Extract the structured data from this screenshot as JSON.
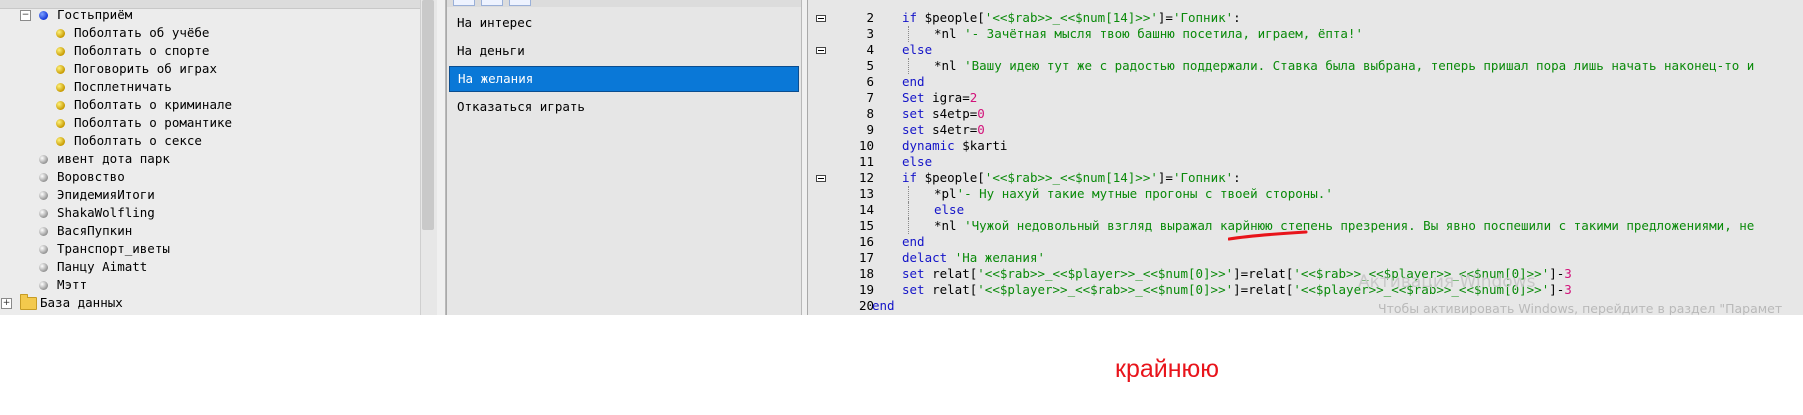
{
  "tree": {
    "items": [
      {
        "label": "Гостьприём",
        "level": 1,
        "icon": "blue-bullet-icon",
        "expander": "−"
      },
      {
        "label": "Поболтать об учёбе",
        "level": 2,
        "icon": "yellow-bullet-icon"
      },
      {
        "label": "Поболтать о спорте",
        "level": 2,
        "icon": "yellow-bullet-icon"
      },
      {
        "label": "Поговорить об играх",
        "level": 2,
        "icon": "yellow-bullet-icon"
      },
      {
        "label": "Посплетничать",
        "level": 2,
        "icon": "yellow-bullet-icon"
      },
      {
        "label": "Поболтать о криминале",
        "level": 2,
        "icon": "yellow-bullet-icon"
      },
      {
        "label": "Поболтать о романтике",
        "level": 2,
        "icon": "yellow-bullet-icon"
      },
      {
        "label": "Поболтать о сексе",
        "level": 2,
        "icon": "yellow-bullet-icon"
      },
      {
        "label": "ивент дота парк",
        "level": 1,
        "icon": "gray-bullet-icon"
      },
      {
        "label": "Воровство",
        "level": 1,
        "icon": "gray-bullet-icon"
      },
      {
        "label": "ЭпидемияИтоги",
        "level": 1,
        "icon": "gray-bullet-icon"
      },
      {
        "label": "ShakaWolfling",
        "level": 1,
        "icon": "gray-bullet-icon"
      },
      {
        "label": "ВасяПупкин",
        "level": 1,
        "icon": "gray-bullet-icon"
      },
      {
        "label": "Транспорт_иветы",
        "level": 1,
        "icon": "gray-bullet-icon"
      },
      {
        "label": "Панцу  Aimatt",
        "level": 1,
        "icon": "gray-bullet-icon"
      },
      {
        "label": "Мэтт",
        "level": 1,
        "icon": "gray-bullet-icon"
      },
      {
        "label": "База данных",
        "level": 0,
        "icon": "folder-icon",
        "expander": "+"
      }
    ]
  },
  "actions": {
    "items": [
      {
        "label": "На интерес",
        "selected": false
      },
      {
        "label": "На деньги",
        "selected": false
      },
      {
        "label": "На желания",
        "selected": true
      },
      {
        "label": "Отказаться играть",
        "selected": false
      }
    ]
  },
  "editor": {
    "lines": [
      {
        "n": "2",
        "fold": true,
        "indent": 1,
        "tokens": [
          [
            "kw",
            "if "
          ],
          [
            "blk",
            "$people["
          ],
          [
            "str",
            "'<<$rab>>_<<$num[14]>>'"
          ],
          [
            "blk",
            "]="
          ],
          [
            "str",
            "'Гопник'"
          ],
          [
            "blk",
            ":"
          ]
        ]
      },
      {
        "n": "3",
        "fold": false,
        "indent": 2,
        "tokens": [
          [
            "blk",
            "*nl "
          ],
          [
            "str",
            "'- Зачётная мысля твою башню посетила, играем, ёпта!'"
          ]
        ]
      },
      {
        "n": "4",
        "fold": true,
        "indent": 1,
        "tokens": [
          [
            "kw",
            "else"
          ]
        ]
      },
      {
        "n": "5",
        "fold": false,
        "indent": 2,
        "tokens": [
          [
            "blk",
            "*nl "
          ],
          [
            "str",
            "'Вашу идею тут же с радостью поддержали. Ставка была выбрана, теперь пришал пора лишь начать наконец-то и"
          ]
        ]
      },
      {
        "n": "6",
        "fold": false,
        "indent": 1,
        "tokens": [
          [
            "kw",
            "end"
          ]
        ]
      },
      {
        "n": "7",
        "fold": false,
        "indent": 1,
        "tokens": [
          [
            "kw",
            "Set "
          ],
          [
            "blk",
            "igra="
          ],
          [
            "num",
            "2"
          ]
        ]
      },
      {
        "n": "8",
        "fold": false,
        "indent": 1,
        "tokens": [
          [
            "kw",
            "set "
          ],
          [
            "blk",
            "s4etp="
          ],
          [
            "num",
            "0"
          ]
        ]
      },
      {
        "n": "9",
        "fold": false,
        "indent": 1,
        "tokens": [
          [
            "kw",
            "set "
          ],
          [
            "blk",
            "s4etr="
          ],
          [
            "num",
            "0"
          ]
        ]
      },
      {
        "n": "10",
        "fold": false,
        "indent": 1,
        "tokens": [
          [
            "kw",
            "dynamic "
          ],
          [
            "blk",
            "$karti"
          ]
        ]
      },
      {
        "n": "11",
        "fold": false,
        "indent": 1,
        "tokens": [
          [
            "kw",
            "else"
          ]
        ]
      },
      {
        "n": "12",
        "fold": true,
        "indent": 1,
        "tokens": [
          [
            "kw",
            "if "
          ],
          [
            "blk",
            "$people["
          ],
          [
            "str",
            "'<<$rab>>_<<$num[14]>>'"
          ],
          [
            "blk",
            "]="
          ],
          [
            "str",
            "'Гопник'"
          ],
          [
            "blk",
            ":"
          ]
        ]
      },
      {
        "n": "13",
        "fold": false,
        "indent": 2,
        "tokens": [
          [
            "blk",
            "*pl"
          ],
          [
            "str",
            "'- Ну нахуй такие мутные прогоны с твоей стороны.'"
          ]
        ]
      },
      {
        "n": "14",
        "fold": false,
        "indent": 2,
        "tokens": [
          [
            "kw",
            "else"
          ]
        ]
      },
      {
        "n": "15",
        "fold": false,
        "indent": 2,
        "tokens": [
          [
            "blk",
            "*nl "
          ],
          [
            "str",
            "'Чужой недовольный взгляд выражал карйнюю степень презрения. Вы явно поспешили с такими предложениями, не"
          ]
        ]
      },
      {
        "n": "16",
        "fold": false,
        "indent": 1,
        "tokens": [
          [
            "kw",
            "end"
          ]
        ]
      },
      {
        "n": "17",
        "fold": false,
        "indent": 1,
        "tokens": [
          [
            "kw",
            "delact "
          ],
          [
            "str",
            "'На желания'"
          ]
        ]
      },
      {
        "n": "18",
        "fold": false,
        "indent": 1,
        "tokens": [
          [
            "kw",
            "set "
          ],
          [
            "blk",
            "relat["
          ],
          [
            "str",
            "'<<$rab>>_<<$player>>_<<$num[0]>>'"
          ],
          [
            "blk",
            "]=relat["
          ],
          [
            "str",
            "'<<$rab>>_<<$player>>_<<$num[0]>>'"
          ],
          [
            "blk",
            "]-"
          ],
          [
            "num",
            "3"
          ]
        ]
      },
      {
        "n": "19",
        "fold": false,
        "indent": 1,
        "tokens": [
          [
            "kw",
            "set "
          ],
          [
            "blk",
            "relat["
          ],
          [
            "str",
            "'<<$player>>_<<$rab>>_<<$num[0]>>'"
          ],
          [
            "blk",
            "]=relat["
          ],
          [
            "str",
            "'<<$player>>_<<$rab>>_<<$num[0]>>'"
          ],
          [
            "blk",
            "]-"
          ],
          [
            "num",
            "3"
          ]
        ]
      },
      {
        "n": "20",
        "fold": false,
        "indent": 0,
        "tokens": [
          [
            "kw",
            "end"
          ]
        ]
      }
    ],
    "watermark_title": "Активация Windows",
    "watermark_sub": "Чтобы активировать Windows, перейдите в раздел \"Парамет"
  },
  "caption": "крайнюю",
  "colors": {
    "selection": "#0a78d7",
    "keyword": "#1414c8",
    "string": "#0a8a0a",
    "number": "#d2127a",
    "annotation": "#e8141b"
  }
}
